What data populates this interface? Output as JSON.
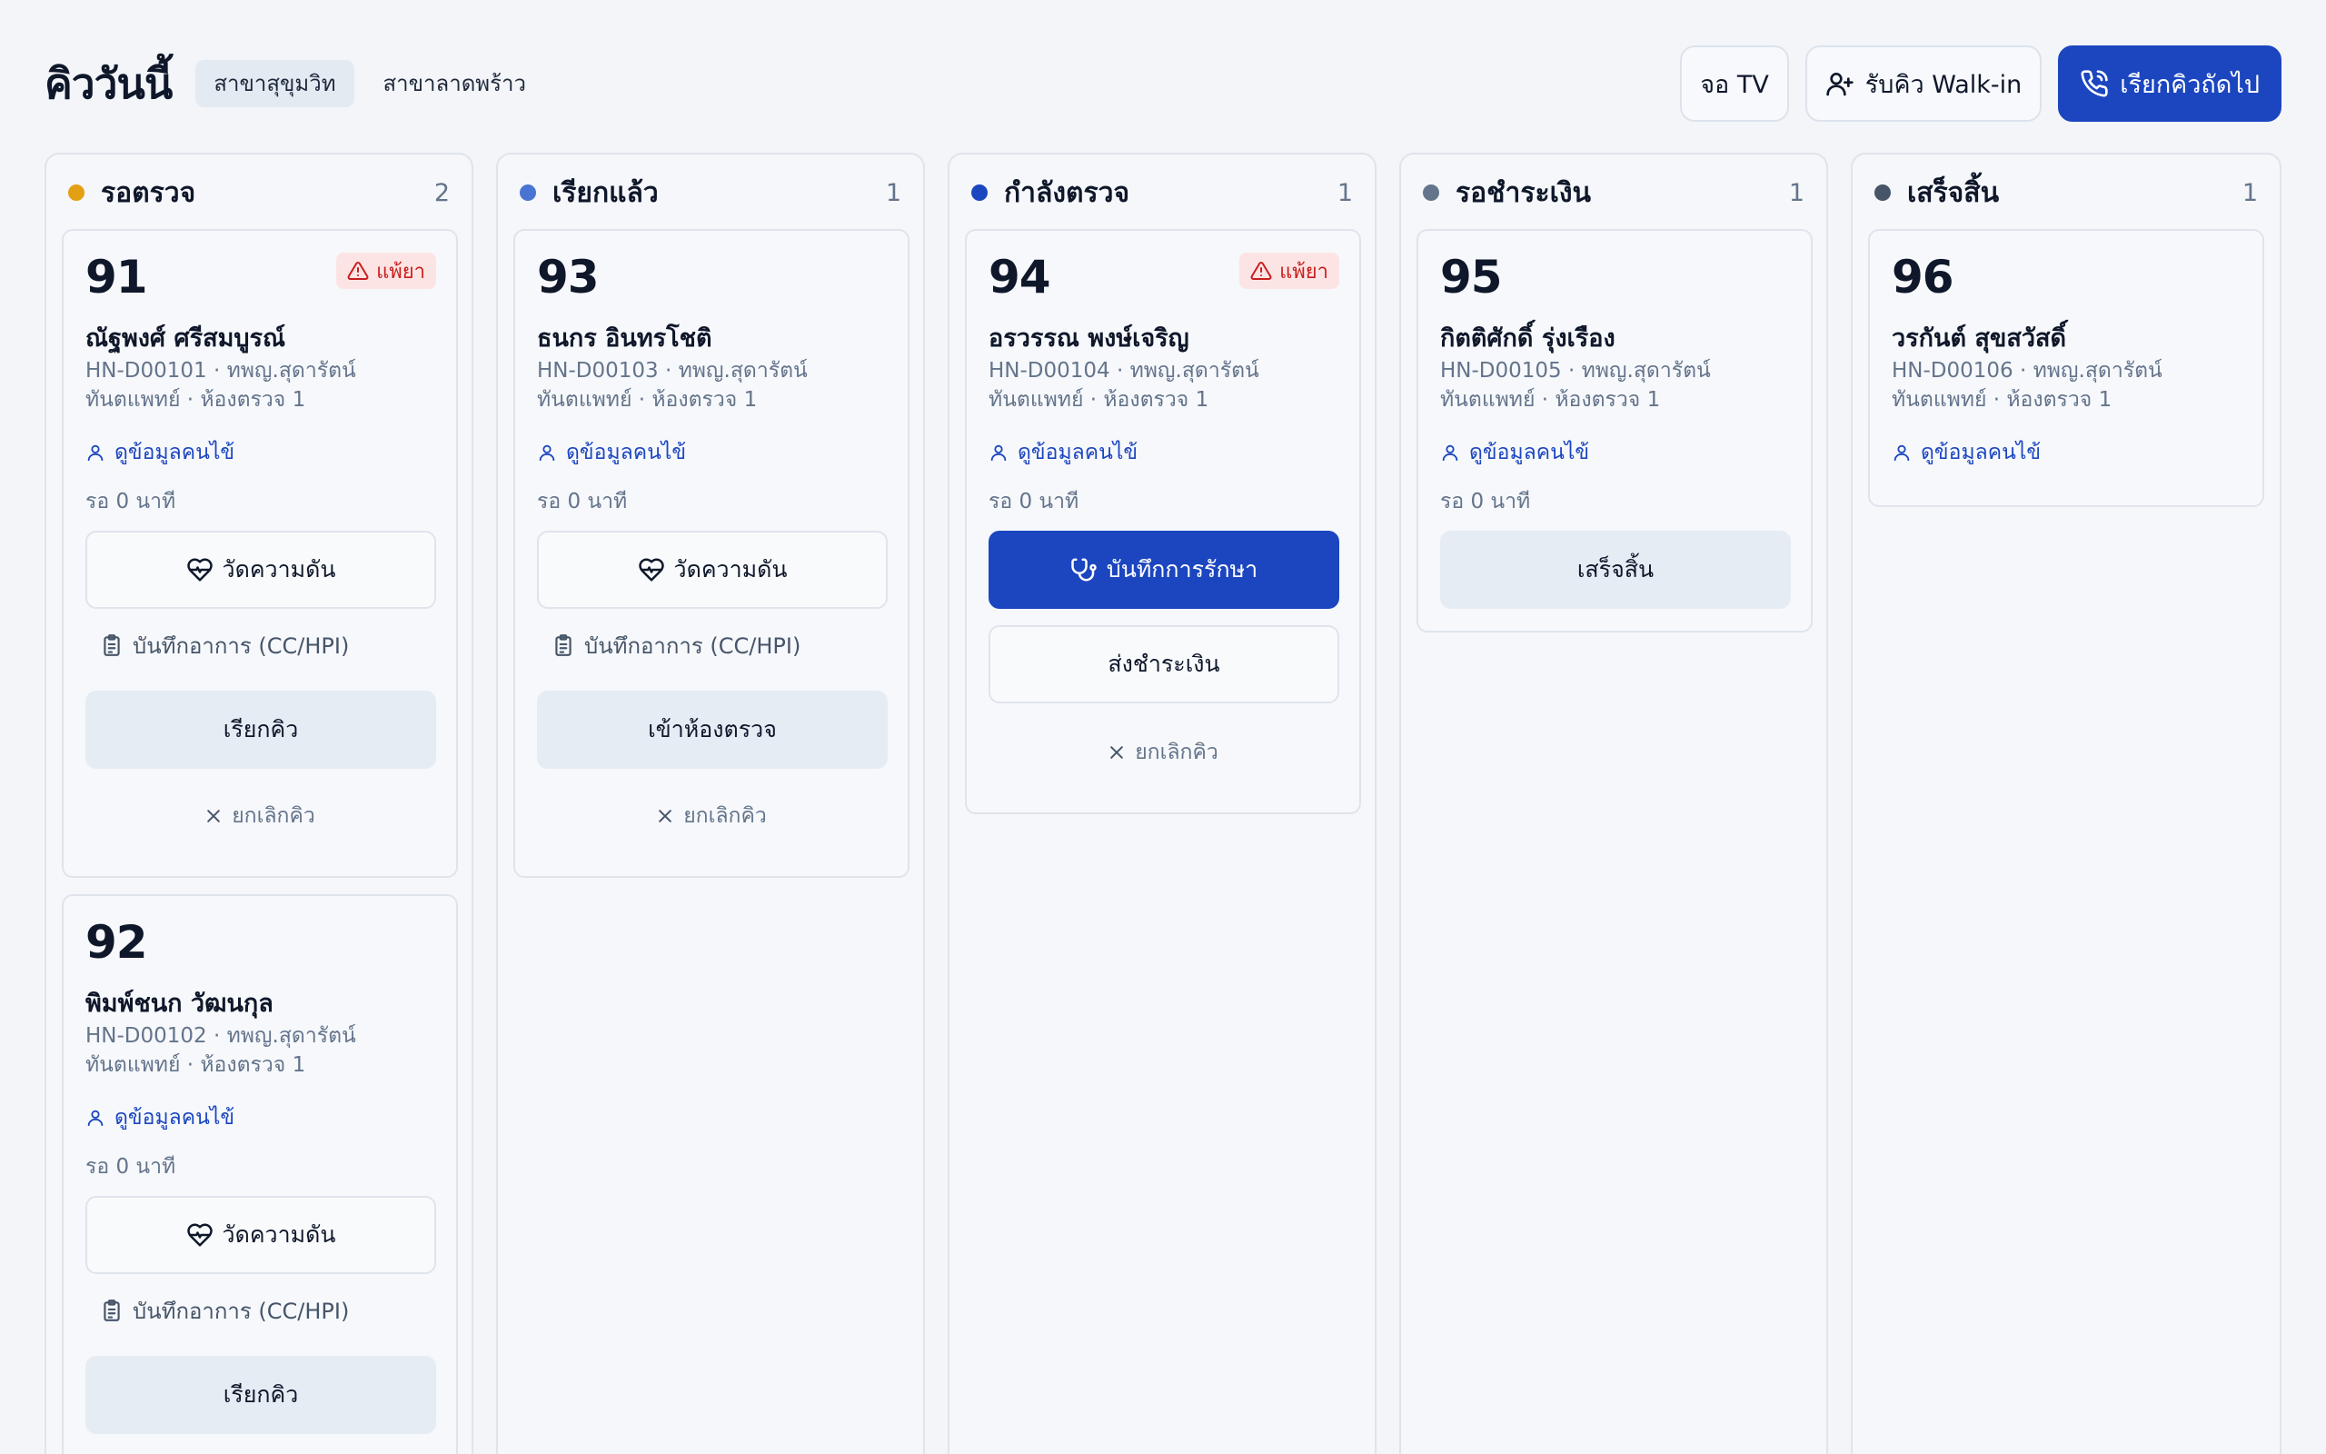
{
  "header": {
    "title": "คิววันนี้",
    "branches": [
      "สาขาสุขุมวิท",
      "สาขาลาดพร้าว"
    ],
    "tv_label": "จอ TV",
    "walkin_label": "รับคิว Walk-in",
    "call_next_label": "เรียกคิวถัดไป"
  },
  "common": {
    "view_patient": "ดูข้อมูลคนไข้",
    "measure_bp": "วัดความดัน",
    "record_symptoms": "บันทึกอาการ (CC/HPI)",
    "cancel_queue": "ยกเลิกคิว",
    "allergy": "แพ้ยา",
    "wait_text": "รอ 0 นาที"
  },
  "columns": [
    {
      "title": "รอตรวจ",
      "count": "2",
      "color": "#e3a014"
    },
    {
      "title": "เรียกแล้ว",
      "count": "1",
      "color": "#4a74d2"
    },
    {
      "title": "กำลังตรวจ",
      "count": "1",
      "color": "#1c46c0"
    },
    {
      "title": "รอชำระเงิน",
      "count": "1",
      "color": "#64748b"
    },
    {
      "title": "เสร็จสิ้น",
      "count": "1",
      "color": "#475569"
    }
  ],
  "cards": {
    "c91": {
      "number": "91",
      "name": "ณัฐพงศ์ ศรีสมบูรณ์",
      "meta1": "HN-D00101 · ทพญ.สุดารัตน์",
      "meta2": "ทันตแพทย์ · ห้องตรวจ 1",
      "action": "เรียกคิว"
    },
    "c92": {
      "number": "92",
      "name": "พิมพ์ชนก วัฒนกุล",
      "meta1": "HN-D00102 · ทพญ.สุดารัตน์",
      "meta2": "ทันตแพทย์ · ห้องตรวจ 1",
      "action": "เรียกคิว"
    },
    "c93": {
      "number": "93",
      "name": "ธนกร อินทรโชติ",
      "meta1": "HN-D00103 · ทพญ.สุดารัตน์",
      "meta2": "ทันตแพทย์ · ห้องตรวจ 1",
      "action": "เข้าห้องตรวจ"
    },
    "c94": {
      "number": "94",
      "name": "อรวรรณ พงษ์เจริญ",
      "meta1": "HN-D00104 · ทพญ.สุดารัตน์",
      "meta2": "ทันตแพทย์ · ห้องตรวจ 1",
      "action": "บันทึกการรักษา",
      "action2": "ส่งชำระเงิน"
    },
    "c95": {
      "number": "95",
      "name": "กิตติศักดิ์ รุ่งเรือง",
      "meta1": "HN-D00105 · ทพญ.สุดารัตน์",
      "meta2": "ทันตแพทย์ · ห้องตรวจ 1",
      "action": "เสร็จสิ้น"
    },
    "c96": {
      "number": "96",
      "name": "วรกันต์ สุขสวัสดิ์",
      "meta1": "HN-D00106 · ทพญ.สุดารัตน์",
      "meta2": "ทันตแพทย์ · ห้องตรวจ 1"
    }
  },
  "colors": {
    "primary": "#1c46c0",
    "allergy_bg": "#fde4e4",
    "allergy_text": "#c81e1e"
  }
}
